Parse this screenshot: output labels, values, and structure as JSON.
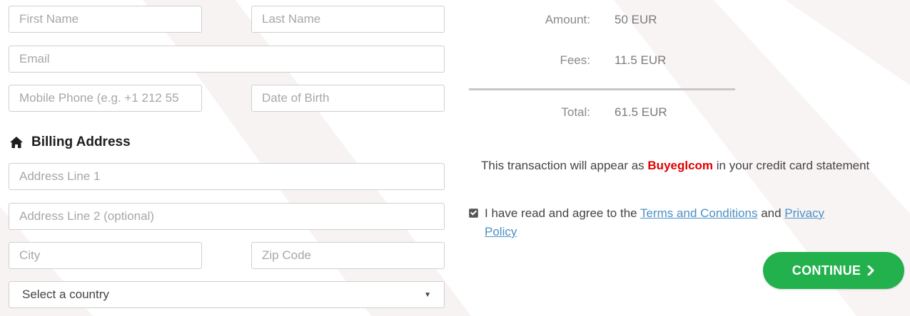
{
  "form": {
    "first_name_placeholder": "First Name",
    "last_name_placeholder": "Last Name",
    "email_placeholder": "Email",
    "phone_placeholder": "Mobile Phone (e.g. +1 212 55",
    "dob_placeholder": "Date of Birth"
  },
  "billing": {
    "title": "Billing Address",
    "icon": "home-icon",
    "address1_placeholder": "Address Line 1",
    "address2_placeholder": "Address Line 2 (optional)",
    "city_placeholder": "City",
    "zip_placeholder": "Zip Code",
    "country_selected": "Select a country"
  },
  "summary": {
    "amount_label": "Amount:",
    "amount_value": "50 EUR",
    "fees_label": "Fees:",
    "fees_value": "11.5 EUR",
    "total_label": "Total:",
    "total_value": "61.5 EUR"
  },
  "statement_note": {
    "prefix": "This transaction will appear as",
    "merchant": "Buyeglcom",
    "suffix": "in your credit card statement"
  },
  "agreement": {
    "checked": true,
    "prefix": "I have read and agree to the",
    "terms_link": "Terms and Conditions",
    "and": "and",
    "privacy_link_part1": "Privacy",
    "privacy_link_part2": "Policy"
  },
  "continue_button": {
    "label": "CONTINUE",
    "icon": "chevron-right-icon"
  },
  "colors": {
    "accent_green": "#23b14d",
    "merchant_red": "#e00000",
    "link_blue": "#4a90c8"
  }
}
